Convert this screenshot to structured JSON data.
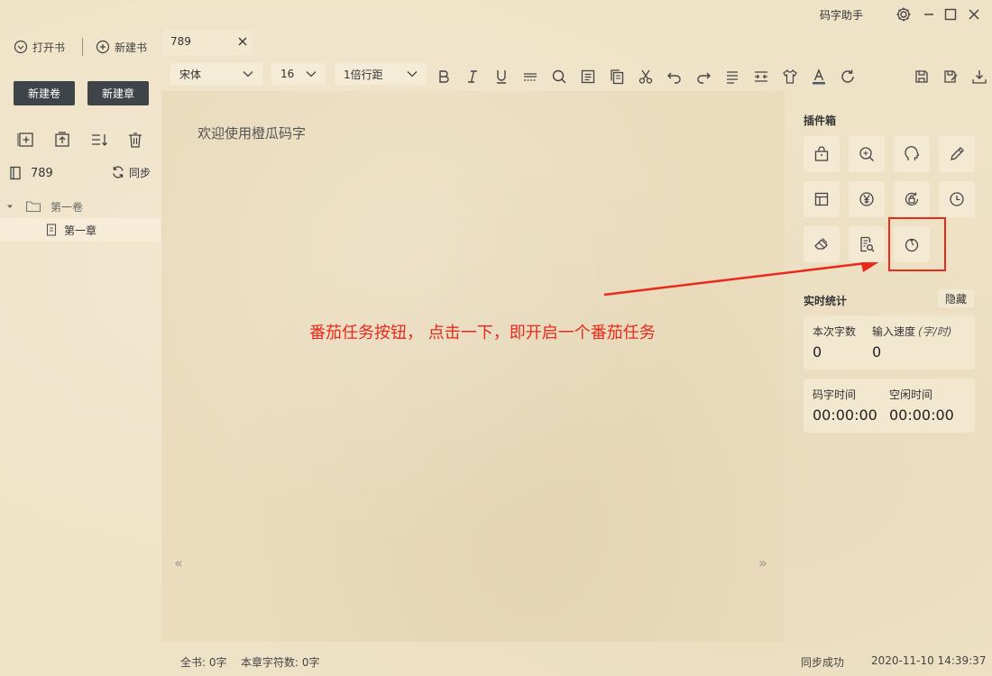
{
  "app": {
    "title": "码字助手"
  },
  "sidebar": {
    "open_book": "打开书",
    "new_book": "新建书",
    "new_volume": "新建卷",
    "new_chapter": "新建章",
    "book_name": "789",
    "sync": "同步",
    "volume": "第一卷",
    "chapter": "第一章"
  },
  "tab": {
    "label": "789"
  },
  "toolbar": {
    "font": "宋体",
    "size": "16",
    "line_spacing": "1倍行距"
  },
  "editor": {
    "content": "欢迎使用橙瓜码字",
    "prev": "«",
    "next": "»"
  },
  "annotation": {
    "text": "番茄任务按钮， 点击一下，即开启一个番茄任务"
  },
  "plugins": {
    "title": "插件箱",
    "items": [
      {
        "icon": "shop-bag-icon"
      },
      {
        "icon": "inspect-icon"
      },
      {
        "icon": "head-icon"
      },
      {
        "icon": "pencil-icon"
      },
      {
        "icon": "layout-icon"
      },
      {
        "icon": "yen-icon"
      },
      {
        "icon": "lock-refresh-icon"
      },
      {
        "icon": "clock-icon"
      },
      {
        "icon": "eraser-icon"
      },
      {
        "icon": "doc-search-icon"
      },
      {
        "icon": "tomato-icon"
      }
    ]
  },
  "stats": {
    "title": "实时统计",
    "hide": "隐藏",
    "word_count_label": "本次字数",
    "word_count": "0",
    "speed_label": "输入速度",
    "speed_unit": "(字/时)",
    "speed": "0",
    "typing_time_label": "码字时间",
    "typing_time": "00:00:00",
    "idle_time_label": "空闲时间",
    "idle_time": "00:00:00"
  },
  "status": {
    "book_total": "全书: 0字",
    "chapter_chars": "本章字符数: 0字",
    "sync_state": "同步成功",
    "datetime": "2020-11-10 14:39:37"
  },
  "colors": {
    "accent_red": "#e8291b",
    "dark_button": "#3f4448",
    "paper": "#efe3c7"
  }
}
